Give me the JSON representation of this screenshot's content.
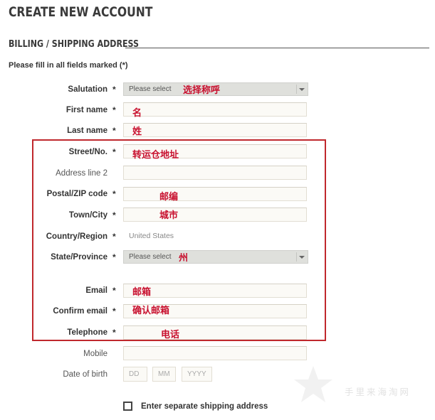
{
  "page_title": "CREATE NEW ACCOUNT",
  "section_title": "BILLING / SHIPPING ADDRESS",
  "required_note": "Please fill in all fields marked (*)",
  "required_marker": "*",
  "fields": {
    "salutation": {
      "label": "Salutation",
      "placeholder": "Please select",
      "annotation": "选择称呼"
    },
    "first_name": {
      "label": "First name",
      "annotation": "名"
    },
    "last_name": {
      "label": "Last name",
      "annotation": "姓"
    },
    "street": {
      "label": "Street/No.",
      "annotation": "转运仓地址"
    },
    "address2": {
      "label": "Address line 2"
    },
    "zip": {
      "label": "Postal/ZIP code",
      "annotation": "邮编"
    },
    "city": {
      "label": "Town/City",
      "annotation": "城市"
    },
    "country": {
      "label": "Country/Region",
      "value": "United States"
    },
    "state": {
      "label": "State/Province",
      "placeholder": "Please select",
      "annotation": "州"
    },
    "email": {
      "label": "Email",
      "annotation": "邮箱"
    },
    "confirm_email": {
      "label": "Confirm email",
      "annotation": "确认邮箱"
    },
    "telephone": {
      "label": "Telephone",
      "annotation": "电话"
    },
    "mobile": {
      "label": "Mobile"
    },
    "dob": {
      "label": "Date of birth",
      "dd": "DD",
      "mm": "MM",
      "yyyy": "YYYY"
    }
  },
  "separate_shipping": {
    "label": "Enter separate shipping address",
    "checked": false
  },
  "watermark": {
    "text": "手里来海淘网"
  },
  "colors": {
    "annotation": "#c8102e",
    "frame": "#c0282d"
  }
}
